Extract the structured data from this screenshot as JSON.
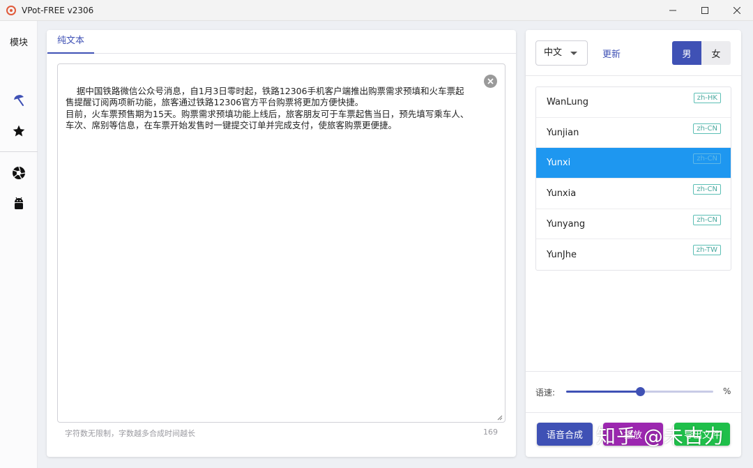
{
  "window": {
    "title": "VPot-FREE v2306",
    "controls": {
      "minimize": "—",
      "maximize": "☐",
      "close": "✕"
    }
  },
  "sidebar": {
    "title": "模块",
    "icons": [
      "umbrella-icon",
      "star-icon",
      "aperture-icon",
      "android-icon"
    ]
  },
  "editor": {
    "tab_label": "纯文本",
    "text": "据中国铁路微信公众号消息，自1月3日零时起，铁路12306手机客户端推出购票需求预填和火车票起售提醒订阅两项新功能，旅客通过铁路12306官方平台购票将更加方便快捷。\n目前，火车票预售期为15天。购票需求预填功能上线后，旅客朋友可于车票起售当日，预先填写乘车人、车次、席别等信息，在车票开始发售时一键提交订单并完成支付，使旅客购票更便捷。",
    "hint": "字符数无限制，字数越多合成时间越长",
    "char_count": "169"
  },
  "voice_panel": {
    "language": "中文",
    "update_label": "更新",
    "gender": {
      "male": "男",
      "female": "女",
      "selected": "male"
    },
    "voices": [
      {
        "name": "WanLung",
        "locale": "zh-HK"
      },
      {
        "name": "Yunjian",
        "locale": "zh-CN"
      },
      {
        "name": "Yunxi",
        "locale": "zh-CN"
      },
      {
        "name": "Yunxia",
        "locale": "zh-CN"
      },
      {
        "name": "Yunyang",
        "locale": "zh-CN"
      },
      {
        "name": "YunJhe",
        "locale": "zh-TW"
      }
    ],
    "selected_voice": "Yunxi",
    "speed_label": "语速:",
    "speed_value": 0.5,
    "percent_label": "%",
    "actions": {
      "synthesize": "语音合成",
      "play": "播放",
      "export": "导出文件"
    }
  },
  "watermark": "知乎 @未古力",
  "colors": {
    "primary": "#3f51b5",
    "selected_row": "#1e97f0",
    "play_button": "#9c27b0",
    "export_button": "#1fbf4a",
    "badge": "#4aa89e"
  }
}
